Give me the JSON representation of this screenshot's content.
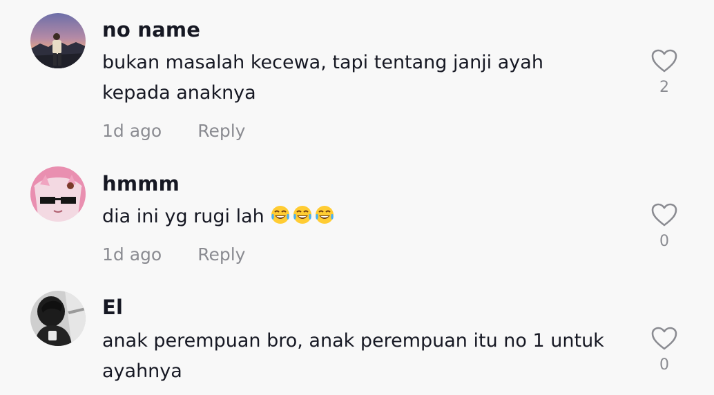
{
  "comments": [
    {
      "username": "no name",
      "text": "bukan masalah kecewa, tapi tentang janji ayah kepada anaknya",
      "time": "1d ago",
      "reply_label": "Reply",
      "likes": "2",
      "avatar_icon": "avatar-sunset-person"
    },
    {
      "username": "hmmm",
      "text": "dia ini yg rugi lah",
      "emoji_name": "tears-of-joy-emoji",
      "time": "1d ago",
      "reply_label": "Reply",
      "likes": "0",
      "avatar_icon": "avatar-pink-anime-sunglasses"
    },
    {
      "username": "El",
      "text": "anak perempuan bro, anak perempuan itu no 1 untuk ayahnya",
      "time": "",
      "reply_label": "",
      "likes": "0",
      "avatar_icon": "avatar-dark-portrait"
    }
  ],
  "colors": {
    "background": "#f8f8f8",
    "username": "#161823",
    "muted": "#8a8b91",
    "heart_outline": "#8a8b91"
  },
  "icons": {
    "like": "heart-outline-icon"
  }
}
